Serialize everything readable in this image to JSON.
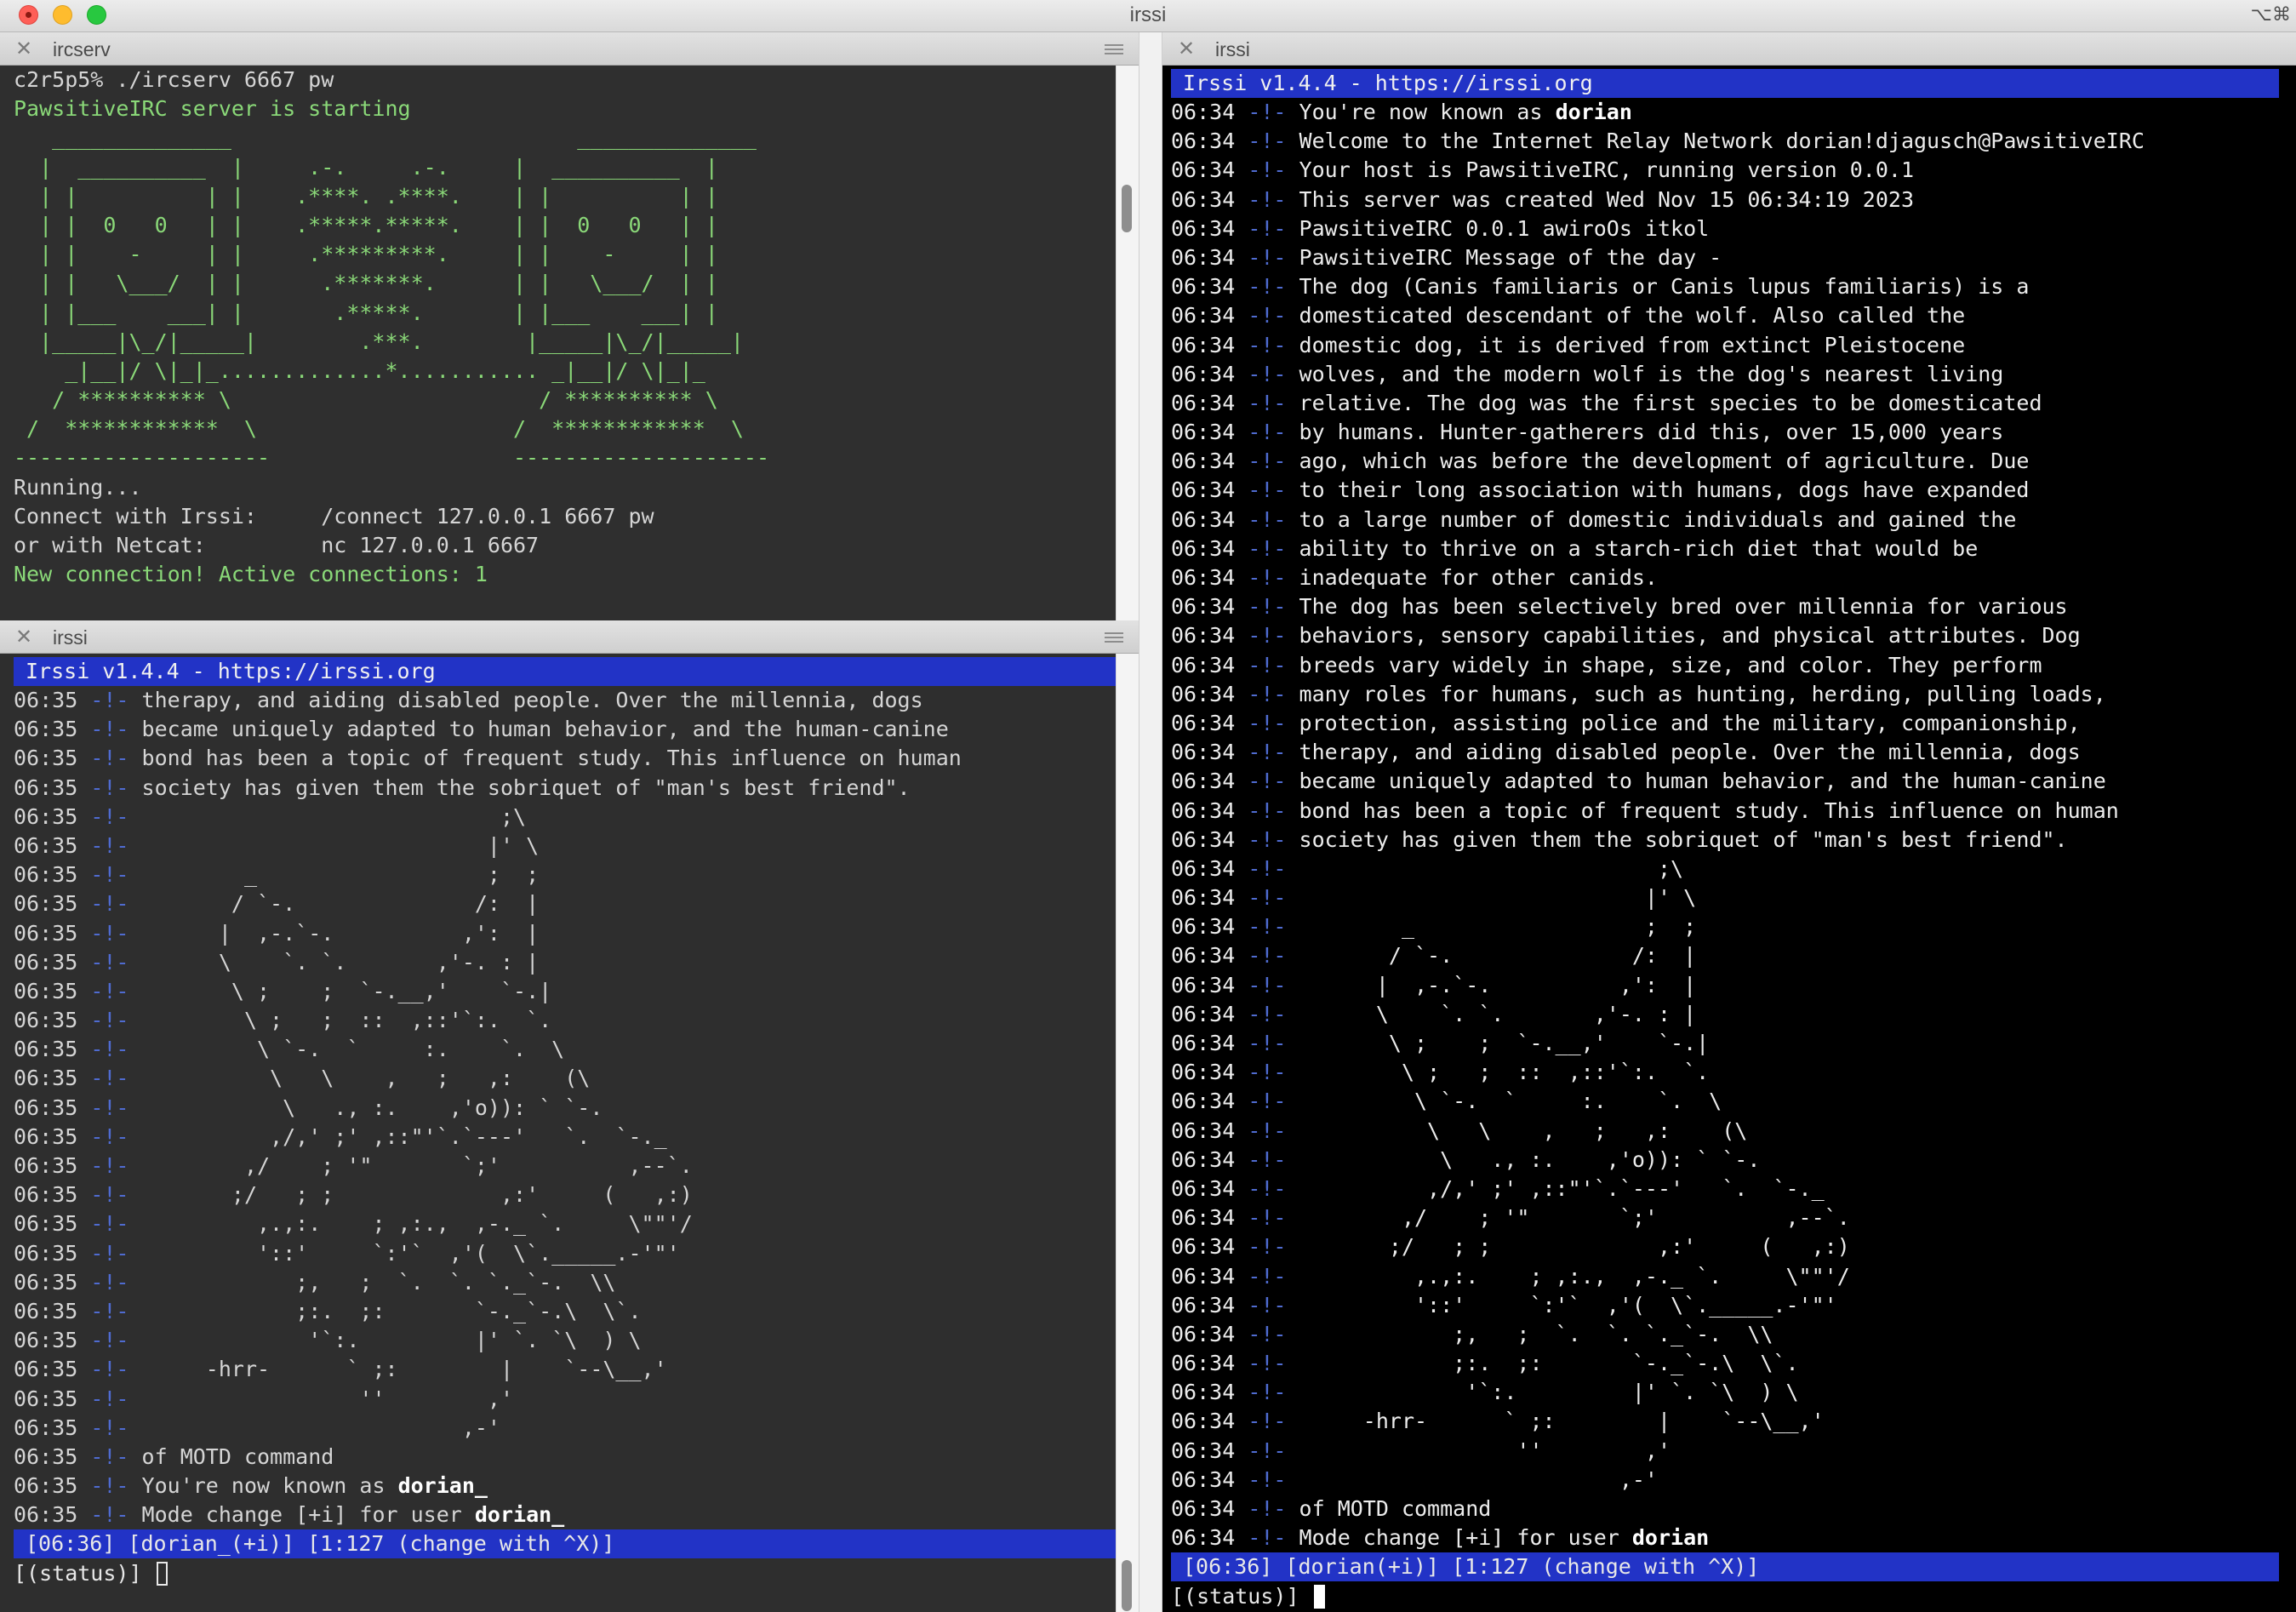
{
  "window": {
    "title": "irssi",
    "keyboard_icon": "⌥⌘"
  },
  "pane_server": {
    "tab_title": "ircserv",
    "lines": [
      {
        "t": "c2r5p5% ./ircserv 6667 pw",
        "c": ""
      },
      {
        "t": "PawsitiveIRC server is starting",
        "c": "green-t"
      },
      {
        "t": "   ______________                           ______________",
        "c": "green-t"
      },
      {
        "t": "  |  __________  |     .-.     .-.     |  __________  |",
        "c": "green-t"
      },
      {
        "t": "  | |          | |    .****. .****.    | |          | |",
        "c": "green-t"
      },
      {
        "t": "  | |  0   0   | |    .*****.*****.    | |  0   0   | |",
        "c": "green-t"
      },
      {
        "t": "  | |    -     | |     .*********.     | |    -     | |",
        "c": "green-t"
      },
      {
        "t": "  | |   \\___/  | |      .*******.      | |   \\___/  | |",
        "c": "green-t"
      },
      {
        "t": "  | |___    ___| |       .*****.       | |___    ___| |",
        "c": "green-t"
      },
      {
        "t": "  |_____|\\_/|_____|        .***.        |_____|\\_/|_____|",
        "c": "green-t"
      },
      {
        "t": "    _|__|/ \\|_|_.............*........... _|__|/ \\|_|_",
        "c": "green-t"
      },
      {
        "t": "   / ********** \\                        / ********** \\",
        "c": "green-t"
      },
      {
        "t": " /  ************  \\                    /  ************  \\",
        "c": "green-t"
      },
      {
        "t": "--------------------                   --------------------",
        "c": "green-t"
      },
      {
        "t": "Running...",
        "c": ""
      },
      {
        "t": "Connect with Irssi:     /connect 127.0.0.1 6667 pw",
        "c": ""
      },
      {
        "t": "or with Netcat:         nc 127.0.0.1 6667",
        "c": ""
      },
      {
        "t": "New connection! Active connections: 1",
        "c": "green-t"
      }
    ]
  },
  "pane_client_left": {
    "tab_title": "irssi",
    "topic": "Irssi v1.4.4 - https://irssi.org",
    "lines": [
      {
        "ts": "06:35",
        "m": "-!-",
        "t": " therapy, and aiding disabled people. Over the millennia, dogs"
      },
      {
        "ts": "06:35",
        "m": "-!-",
        "t": " became uniquely adapted to human behavior, and the human-canine"
      },
      {
        "ts": "06:35",
        "m": "-!-",
        "t": " bond has been a topic of frequent study. This influence on human"
      },
      {
        "ts": "06:35",
        "m": "-!-",
        "t": " society has given them the sobriquet of \"man's best friend\"."
      },
      {
        "ts": "06:35",
        "m": "-!-",
        "t": "                             ;\\"
      },
      {
        "ts": "06:35",
        "m": "-!-",
        "t": "                            |' \\"
      },
      {
        "ts": "06:35",
        "m": "-!-",
        "t": "         _                  ;  ;"
      },
      {
        "ts": "06:35",
        "m": "-!-",
        "t": "        / `-.              /:  |"
      },
      {
        "ts": "06:35",
        "m": "-!-",
        "t": "       |  ,-.`-.          ,':  |"
      },
      {
        "ts": "06:35",
        "m": "-!-",
        "t": "       \\    `. `.       ,'-. : |"
      },
      {
        "ts": "06:35",
        "m": "-!-",
        "t": "        \\ ;    ;  `-.__,'    `-.|"
      },
      {
        "ts": "06:35",
        "m": "-!-",
        "t": "         \\ ;   ;  ::  ,::'`:.  `."
      },
      {
        "ts": "06:35",
        "m": "-!-",
        "t": "          \\ `-.  `     :.    `.  \\"
      },
      {
        "ts": "06:35",
        "m": "-!-",
        "t": "           \\   \\    ,   ;   ,:    (\\"
      },
      {
        "ts": "06:35",
        "m": "-!-",
        "t": "            \\   ., :.    ,'o)): ` `-."
      },
      {
        "ts": "06:35",
        "m": "-!-",
        "t": "           ,/,' ;' ,::\"'`.`---'   `.  `-._"
      },
      {
        "ts": "06:35",
        "m": "-!-",
        "t": "         ,/    ; '\"       `;'          ,--`."
      },
      {
        "ts": "06:35",
        "m": "-!-",
        "t": "        ;/   ; ;             ,:'     (   ,:)"
      },
      {
        "ts": "06:35",
        "m": "-!-",
        "t": "          ,.,:.    ; ,:.,  ,-._ `.     \\\"\"'/"
      },
      {
        "ts": "06:35",
        "m": "-!-",
        "t": "          '::'     `:'`  ,'(  \\`._____.-'\"'"
      },
      {
        "ts": "06:35",
        "m": "-!-",
        "t": "             ;,   ;  `.  `. `._`-.  \\\\"
      },
      {
        "ts": "06:35",
        "m": "-!-",
        "t": "             ;:.  ;:       `-._`-.\\  \\`."
      },
      {
        "ts": "06:35",
        "m": "-!-",
        "t": "              '`:.         |' `. `\\  ) \\"
      },
      {
        "ts": "06:35",
        "m": "-!-",
        "t": "      -hrr-      ` ;:        |    `--\\__,'"
      },
      {
        "ts": "06:35",
        "m": "-!-",
        "t": "                  ''        ,'"
      },
      {
        "ts": "06:35",
        "m": "-!-",
        "t": "                          ,-'"
      },
      {
        "ts": "06:35",
        "m": "-!-",
        "t": " of MOTD command"
      },
      {
        "ts": "06:35",
        "m": "-!-",
        "t": " You're now known as ",
        "b": "dorian_"
      },
      {
        "ts": "06:35",
        "m": "-!-",
        "t": " Mode change [+i] for user ",
        "b": "dorian_"
      }
    ],
    "status": "[06:36] [dorian_(+i)] [1:127 (change with ^X)]",
    "prompt": "[(status)] "
  },
  "pane_client_right": {
    "tab_title": "irssi",
    "topic": "Irssi v1.4.4 - https://irssi.org",
    "lines": [
      {
        "ts": "06:34",
        "m": "-!-",
        "t": " You're now known as ",
        "b": "dorian"
      },
      {
        "ts": "06:34",
        "m": "-!-",
        "t": " Welcome to the Internet Relay Network dorian!djagusch@PawsitiveIRC"
      },
      {
        "ts": "06:34",
        "m": "-!-",
        "t": " Your host is PawsitiveIRC, running version 0.0.1"
      },
      {
        "ts": "06:34",
        "m": "-!-",
        "t": " This server was created Wed Nov 15 06:34:19 2023"
      },
      {
        "ts": "06:34",
        "m": "-!-",
        "t": " PawsitiveIRC 0.0.1 awiroOs itkol"
      },
      {
        "ts": "06:34",
        "m": "-!-",
        "t": " PawsitiveIRC Message of the day -"
      },
      {
        "ts": "06:34",
        "m": "-!-",
        "t": " The dog (Canis familiaris or Canis lupus familiaris) is a"
      },
      {
        "ts": "06:34",
        "m": "-!-",
        "t": " domesticated descendant of the wolf. Also called the"
      },
      {
        "ts": "06:34",
        "m": "-!-",
        "t": " domestic dog, it is derived from extinct Pleistocene"
      },
      {
        "ts": "06:34",
        "m": "-!-",
        "t": " wolves, and the modern wolf is the dog's nearest living"
      },
      {
        "ts": "06:34",
        "m": "-!-",
        "t": " relative. The dog was the first species to be domesticated"
      },
      {
        "ts": "06:34",
        "m": "-!-",
        "t": " by humans. Hunter-gatherers did this, over 15,000 years"
      },
      {
        "ts": "06:34",
        "m": "-!-",
        "t": " ago, which was before the development of agriculture. Due"
      },
      {
        "ts": "06:34",
        "m": "-!-",
        "t": " to their long association with humans, dogs have expanded"
      },
      {
        "ts": "06:34",
        "m": "-!-",
        "t": " to a large number of domestic individuals and gained the"
      },
      {
        "ts": "06:34",
        "m": "-!-",
        "t": " ability to thrive on a starch-rich diet that would be"
      },
      {
        "ts": "06:34",
        "m": "-!-",
        "t": " inadequate for other canids."
      },
      {
        "ts": "06:34",
        "m": "-!-",
        "t": " The dog has been selectively bred over millennia for various"
      },
      {
        "ts": "06:34",
        "m": "-!-",
        "t": " behaviors, sensory capabilities, and physical attributes. Dog"
      },
      {
        "ts": "06:34",
        "m": "-!-",
        "t": " breeds vary widely in shape, size, and color. They perform"
      },
      {
        "ts": "06:34",
        "m": "-!-",
        "t": " many roles for humans, such as hunting, herding, pulling loads,"
      },
      {
        "ts": "06:34",
        "m": "-!-",
        "t": " protection, assisting police and the military, companionship,"
      },
      {
        "ts": "06:34",
        "m": "-!-",
        "t": " therapy, and aiding disabled people. Over the millennia, dogs"
      },
      {
        "ts": "06:34",
        "m": "-!-",
        "t": " became uniquely adapted to human behavior, and the human-canine"
      },
      {
        "ts": "06:34",
        "m": "-!-",
        "t": " bond has been a topic of frequent study. This influence on human"
      },
      {
        "ts": "06:34",
        "m": "-!-",
        "t": " society has given them the sobriquet of \"man's best friend\"."
      },
      {
        "ts": "06:34",
        "m": "-!-",
        "t": "                             ;\\"
      },
      {
        "ts": "06:34",
        "m": "-!-",
        "t": "                            |' \\"
      },
      {
        "ts": "06:34",
        "m": "-!-",
        "t": "         _                  ;  ;"
      },
      {
        "ts": "06:34",
        "m": "-!-",
        "t": "        / `-.              /:  |"
      },
      {
        "ts": "06:34",
        "m": "-!-",
        "t": "       |  ,-.`-.          ,':  |"
      },
      {
        "ts": "06:34",
        "m": "-!-",
        "t": "       \\    `. `.       ,'-. : |"
      },
      {
        "ts": "06:34",
        "m": "-!-",
        "t": "        \\ ;    ;  `-.__,'    `-.|"
      },
      {
        "ts": "06:34",
        "m": "-!-",
        "t": "         \\ ;   ;  ::  ,::'`:.  `."
      },
      {
        "ts": "06:34",
        "m": "-!-",
        "t": "          \\ `-.  `     :.    `.  \\"
      },
      {
        "ts": "06:34",
        "m": "-!-",
        "t": "           \\   \\    ,   ;   ,:    (\\"
      },
      {
        "ts": "06:34",
        "m": "-!-",
        "t": "            \\   ., :.    ,'o)): ` `-."
      },
      {
        "ts": "06:34",
        "m": "-!-",
        "t": "           ,/,' ;' ,::\"'`.`---'   `.  `-._"
      },
      {
        "ts": "06:34",
        "m": "-!-",
        "t": "         ,/    ; '\"       `;'          ,--`."
      },
      {
        "ts": "06:34",
        "m": "-!-",
        "t": "        ;/   ; ;             ,:'     (   ,:)"
      },
      {
        "ts": "06:34",
        "m": "-!-",
        "t": "          ,.,:.    ; ,:.,  ,-._ `.     \\\"\"'/"
      },
      {
        "ts": "06:34",
        "m": "-!-",
        "t": "          '::'     `:'`  ,'(  \\`._____.-'\"'"
      },
      {
        "ts": "06:34",
        "m": "-!-",
        "t": "             ;,   ;  `.  `. `._`-.  \\\\"
      },
      {
        "ts": "06:34",
        "m": "-!-",
        "t": "             ;:.  ;:       `-._`-.\\  \\`."
      },
      {
        "ts": "06:34",
        "m": "-!-",
        "t": "              '`:.         |' `. `\\  ) \\"
      },
      {
        "ts": "06:34",
        "m": "-!-",
        "t": "      -hrr-      ` ;:        |    `--\\__,'"
      },
      {
        "ts": "06:34",
        "m": "-!-",
        "t": "                  ''        ,'"
      },
      {
        "ts": "06:34",
        "m": "-!-",
        "t": "                          ,-'"
      },
      {
        "ts": "06:34",
        "m": "-!-",
        "t": " of MOTD command"
      },
      {
        "ts": "06:34",
        "m": "-!-",
        "t": " Mode change [+i] for user ",
        "b": "dorian"
      }
    ],
    "status": "[06:36] [dorian(+i)] [1:127 (change with ^X)]",
    "prompt": "[(status)] "
  },
  "colors": {
    "topic_bar": "#2233c6",
    "server_green": "#8ad878",
    "marker_blue": "#4f6bd0",
    "left_bg": "#2e2e2e",
    "right_bg": "#000000"
  },
  "icons": {
    "close": "✕",
    "menu": "hamburger-lines"
  }
}
